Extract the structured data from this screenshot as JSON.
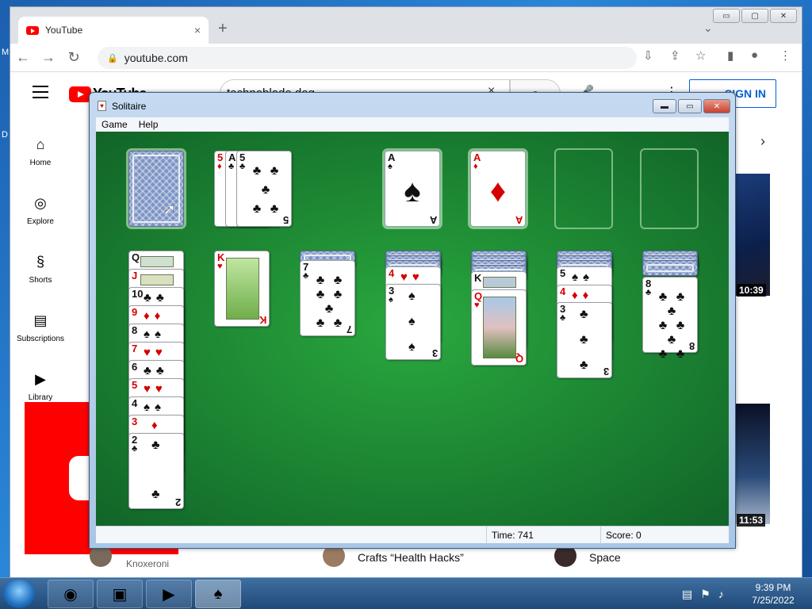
{
  "desktop": {
    "left_letters": [
      "M",
      "D"
    ]
  },
  "chrome": {
    "tab_title": "YouTube",
    "tab_close": "×",
    "new_tab": "+",
    "tab_search": "⌄",
    "url": "youtube.com",
    "win_buttons": [
      "▭",
      "▢",
      "✕"
    ]
  },
  "youtube": {
    "logo_text": "YouTube",
    "search_value": "technoblade dog",
    "search_clear": "×",
    "signin": "SIGN IN",
    "sidebar": [
      {
        "icon": "home-icon",
        "glyph": "⌂",
        "label": "Home"
      },
      {
        "icon": "explore-icon",
        "glyph": "◎",
        "label": "Explore"
      },
      {
        "icon": "shorts-icon",
        "glyph": "§",
        "label": "Shorts"
      },
      {
        "icon": "subscriptions-icon",
        "glyph": "▤",
        "label": "Subscriptions"
      },
      {
        "icon": "library-icon",
        "glyph": "▶",
        "label": "Library"
      }
    ],
    "thumb1_duration": "10:39",
    "thumb2_duration": "11:53",
    "channel_1": "Knoxeroni",
    "video_title_2": "Crafts “Health Hacks”",
    "video_title_3": "Space"
  },
  "solitaire": {
    "title": "Solitaire",
    "menu": [
      "Game",
      "Help"
    ],
    "win_buttons": [
      "▬",
      "▭",
      "✕"
    ],
    "status": {
      "time_label": "Time:",
      "time_value": "741",
      "score_label": "Score:",
      "score_value": "0"
    },
    "stock": "face-down deck",
    "waste": [
      "5♦",
      "A♣",
      "5♣"
    ],
    "foundations": [
      "A♠",
      "A♦",
      "",
      ""
    ],
    "tableau": [
      [
        "Q♠",
        "J♦",
        "10♣",
        "9♦",
        "8♠",
        "7♥",
        "6♣",
        "5♥",
        "4♠",
        "3♦",
        "2♣"
      ],
      [
        "K♥"
      ],
      [
        "7♣"
      ],
      [
        "4♥",
        "3♠"
      ],
      [
        "K♠",
        "Q♥"
      ],
      [
        "5♠",
        "4♦",
        "3♣"
      ],
      [
        "8♣"
      ]
    ],
    "face_down_counts": [
      0,
      0,
      1,
      3,
      4,
      3,
      3
    ],
    "colors": {
      "felt": "#1e8a34",
      "red_suit": "#d40000",
      "black_suit": "#111111"
    }
  },
  "taskbar": {
    "apps": [
      "chrome-icon",
      "explorer-icon",
      "media-player-icon",
      "solitaire-icon"
    ],
    "clock_time": "9:39 PM",
    "clock_date": "7/25/2022"
  }
}
